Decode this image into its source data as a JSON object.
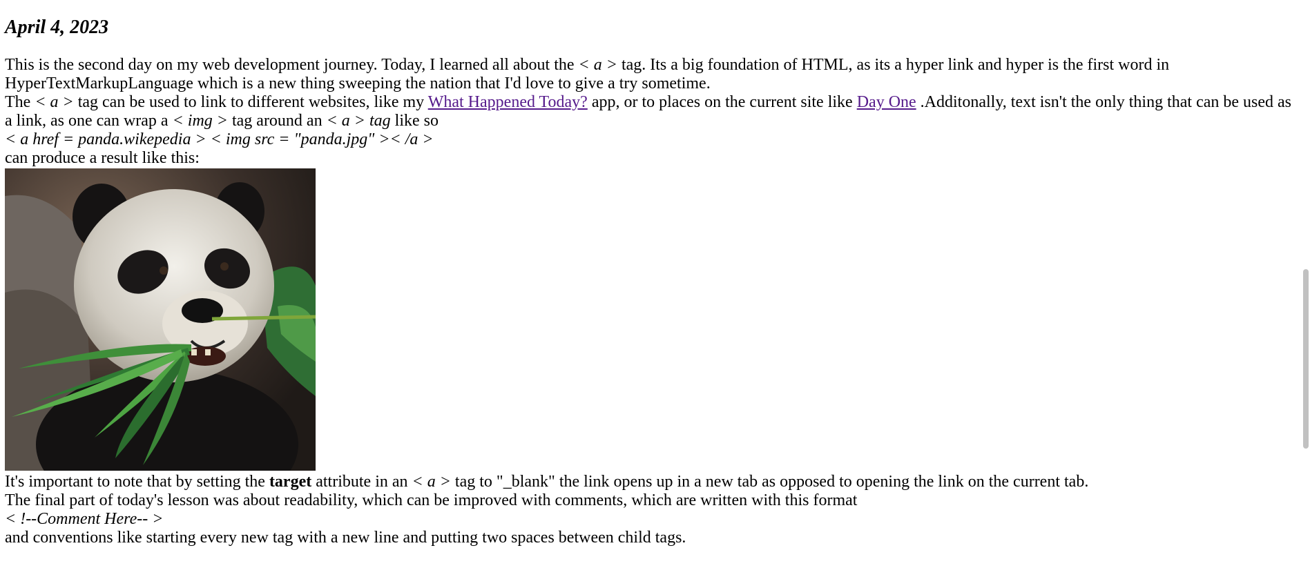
{
  "post": {
    "date": "April 4, 2023",
    "p1": {
      "a": "This is the second day on my web development journey. Today, I learned all about the ",
      "tag": "< a >",
      "b": " tag. Its a big foundation of HTML, as its a hyper link and hyper is the first word in",
      "c": "HyperTextMarkupLanguage which is a new thing sweeping the nation that I'd love to give a try sometime."
    },
    "p2": {
      "a": "The ",
      "tag1": "< a >",
      "b": " tag can be used to link to different websites, like my ",
      "link1": "What Happened Today?",
      "c": " app, or to places on the current site like ",
      "link2": "Day One",
      "d": " .Additonally, text isn't the only thing that can be used as",
      "e": "a link, as one can wrap a ",
      "tag2": "< img >",
      "f": " tag around an ",
      "tag3": "< a > tag",
      "g": " like so"
    },
    "code_example": "< a href = panda.wikepedia > < img src = \"panda.jpg\" >< /a >",
    "result_text": "can produce a result like this:",
    "image": {
      "icon": "panda-photo",
      "alt": "Panda eating bamboo"
    },
    "p3": {
      "a": "It's important to note that by setting the ",
      "bold": "target",
      "b": " attribute in an ",
      "tag": "< a >",
      "c": " tag to \"_blank\" the link opens up in a new tab as opposed to opening the link on the current tab."
    },
    "p4": "The final part of today's lesson was about readability, which can be improved with comments, which are written with this format",
    "comment_example": "< !--Comment Here-- >",
    "p5": "and conventions like starting every new tag with a new line and putting two spaces between child tags."
  },
  "colors": {
    "link": "#551a8b",
    "text": "#000000",
    "background": "#ffffff"
  }
}
